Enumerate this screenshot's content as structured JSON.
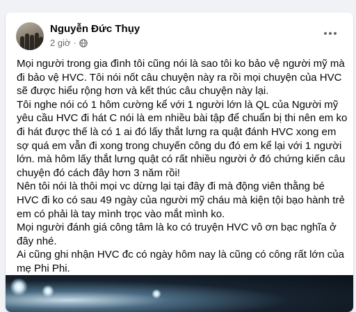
{
  "post": {
    "author": "Nguyễn Đức Thụy",
    "time": "2 giờ",
    "time_separator": "·",
    "paragraphs": [
      "Mọi người trong gia đình tôi cũng nói là sao tôi ko bảo vệ người mỹ mà đi bảo vệ HVC. Tôi nói nốt câu chuyện này ra rồi mọi chuyện của HVC sẽ được hiểu rộng hơn và kết thúc câu chuyện này lại.",
      "Tôi nghe nói có 1 hôm cường kể với 1 người lớn là QL của Người mỹ yêu cầu HVC đi hát C nói là em nhiều bài tập để chuẩn bị thi nên em ko đi hát được thế là có 1 ai đó lấy thắt lưng ra quật đánh HVC xong em sợ quá em vẫn đi xong trong chuyến công du đó em kể lại với 1 người lớn. mà hôm lấy thắt lưng quật có rất nhiều người ở đó chứng kiến câu chuyện đó cách đây hơn 3 năm rồi!",
      "Nên tôi nói là thôi mọi vc dừng lại tại đây đi mà động viên thằng bé HVC đi ko có sau 49 ngày của người mỹ cháu mà kiện tội bạo hành trẻ em có phải là tay mình trọc vào mắt mình ko.",
      "Mọi người đánh giá công tâm là ko có truyện HVC vô ơn bạc nghĩa ở đây nhé.",
      "Ai cũng ghi nhận HVC đc có ngày hôm nay là cũng có công rất lớn của mẹ Phi Phi."
    ]
  },
  "icons": {
    "privacy": "globe-icon",
    "menu": "more-horizontal-icon"
  },
  "colors": {
    "page_background": "#f0f2f5",
    "card_background": "#ffffff",
    "text_primary": "#050505",
    "text_secondary": "#65676b"
  }
}
